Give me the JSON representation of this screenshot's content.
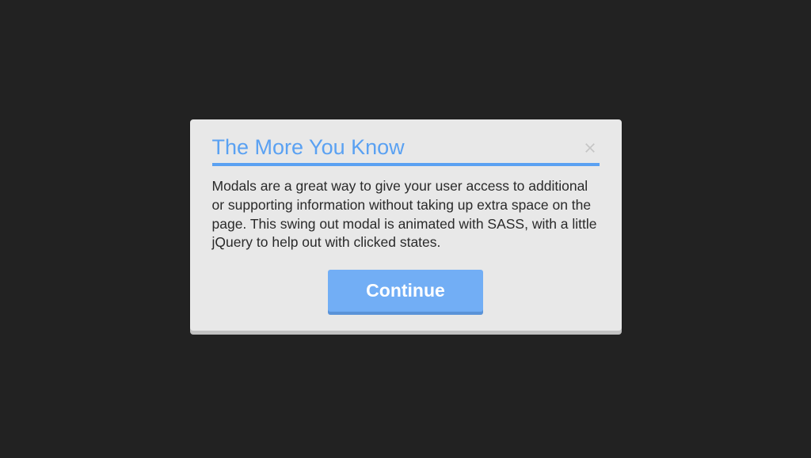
{
  "modal": {
    "title": "The More You Know",
    "body": "Modals are a great way to give your user access to additional or supporting information without taking up extra space on the page. This swing out modal is animated with SASS, with a little jQuery to help out with clicked states.",
    "continue_label": "Continue"
  }
}
